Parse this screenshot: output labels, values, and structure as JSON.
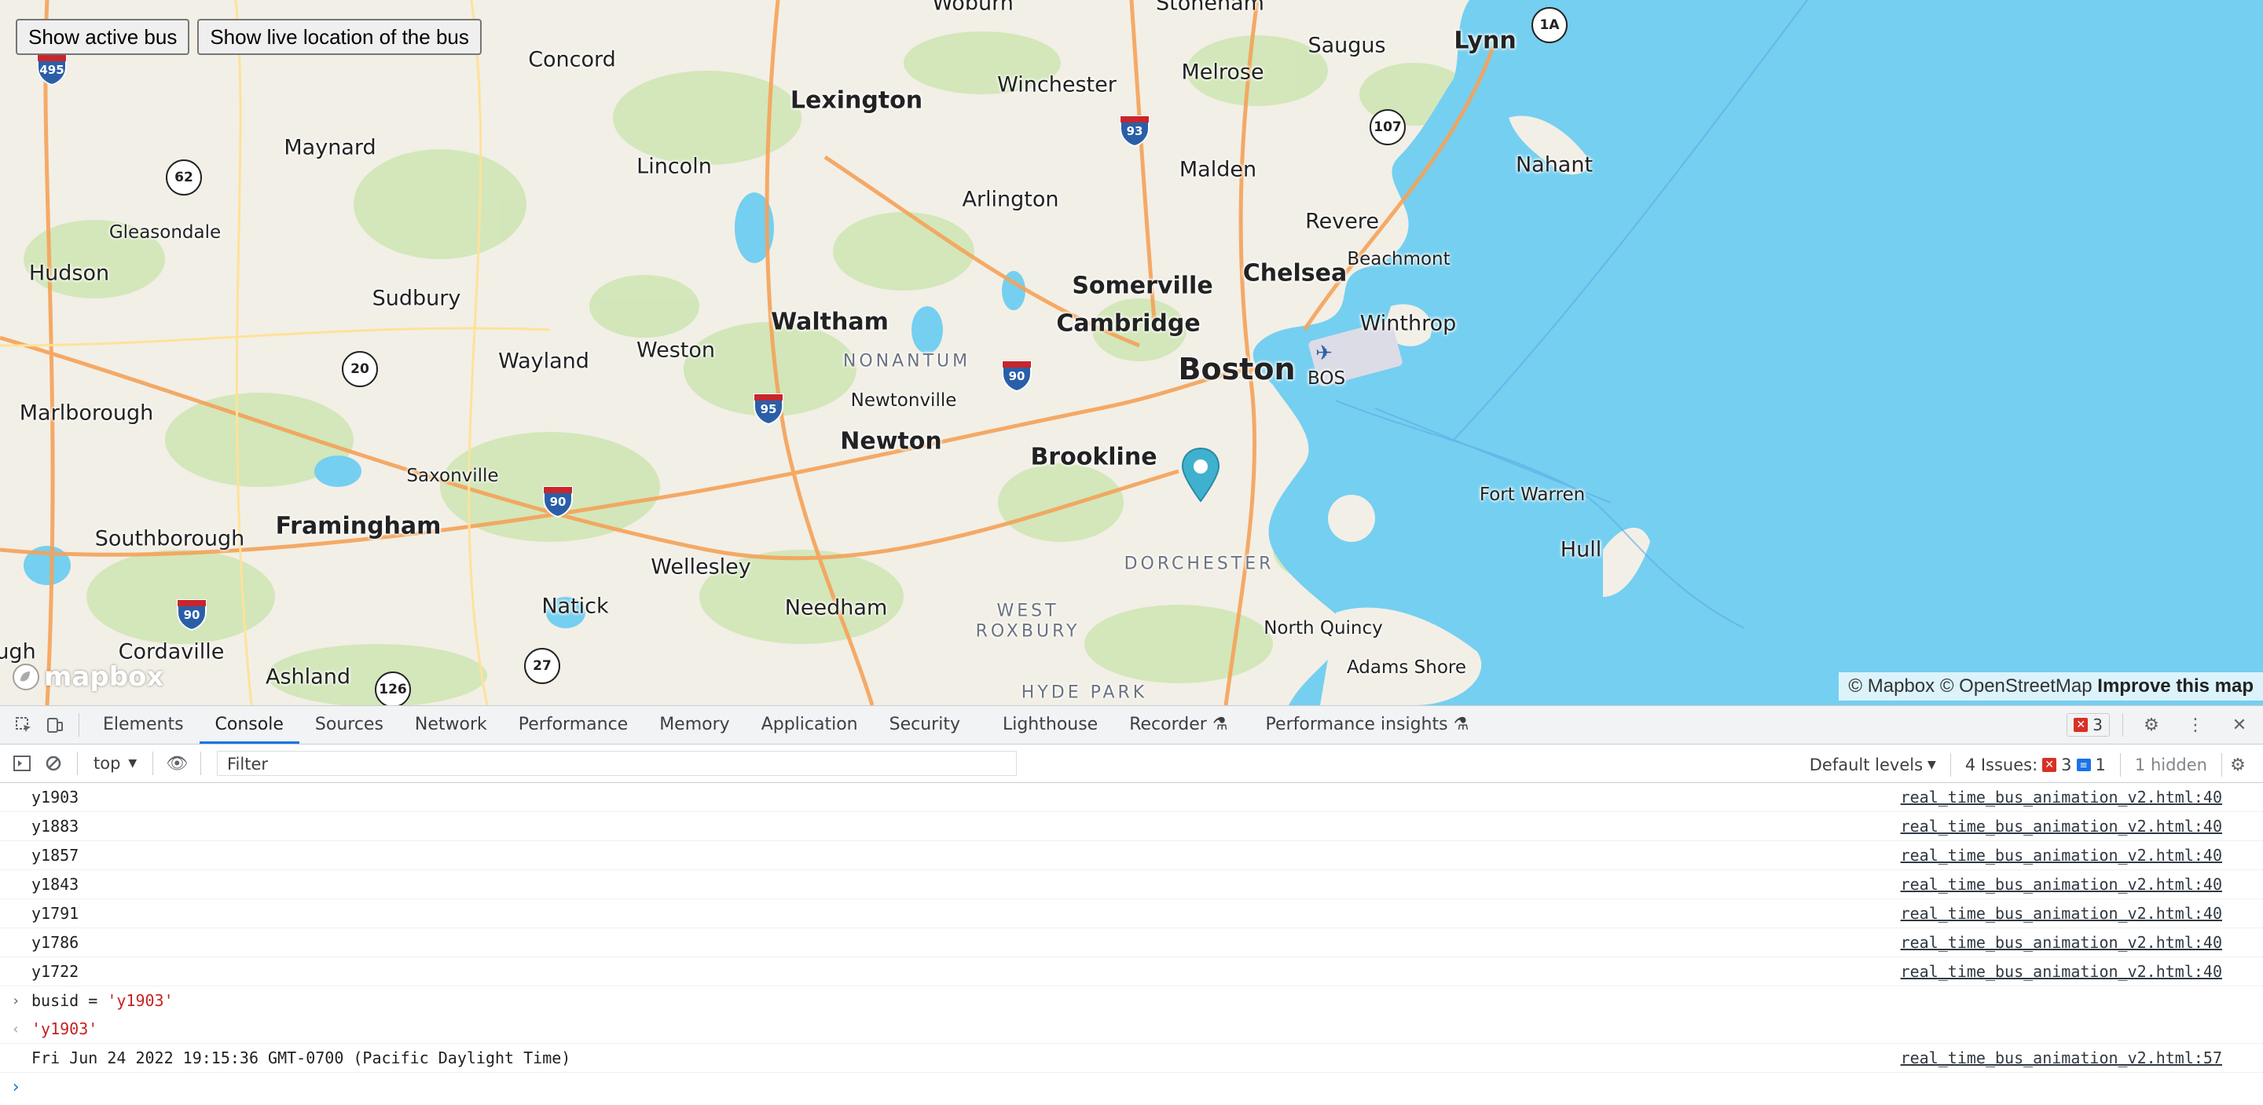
{
  "map": {
    "buttons": {
      "active_bus": "Show active bus",
      "live_location": "Show live location of the bus"
    },
    "labels": {
      "woburn": "Woburn",
      "stoneham": "Stoneham",
      "concord": "Concord",
      "lexington": "Lexington",
      "winchester": "Winchester",
      "melrose": "Melrose",
      "saugus": "Saugus",
      "lynn": "Lynn",
      "maynard": "Maynard",
      "lincoln": "Lincoln",
      "malden": "Malden",
      "nahant": "Nahant",
      "arlington": "Arlington",
      "gleasondale": "Gleasondale",
      "revere": "Revere",
      "hudson": "Hudson",
      "beachmont": "Beachmont",
      "somerville": "Somerville",
      "chelsea": "Chelsea",
      "sudbury": "Sudbury",
      "waltham": "Waltham",
      "cambridge": "Cambridge",
      "winthrop": "Winthrop",
      "wayland": "Wayland",
      "weston": "Weston",
      "nonantum": "NONANTUM",
      "boston": "Boston",
      "bos": "BOS",
      "newtonville": "Newtonville",
      "marlborough": "Marlborough",
      "newton": "Newton",
      "brookline": "Brookline",
      "saxonville": "Saxonville",
      "fort_warren": "Fort Warren",
      "southborough": "Southborough",
      "framingham": "Framingham",
      "dorchester": "DORCHESTER",
      "hull": "Hull",
      "wellesley": "Wellesley",
      "natick": "Natick",
      "needham": "Needham",
      "west": "WEST",
      "roxbury": "ROXBURY",
      "north_quincy": "North Quincy",
      "cordaville": "Cordaville",
      "hugh": "ugh",
      "ashland": "Ashland",
      "hyde_park": "HYDE PARK",
      "adams_shore": "Adams Shore"
    },
    "shields": {
      "i495": "495",
      "r62": "62",
      "r1a": "1A",
      "r107": "107",
      "i93": "93",
      "r20": "20",
      "i95": "95",
      "i90a": "90",
      "i90b": "90",
      "i90c": "90",
      "r27": "27",
      "r126": "126"
    },
    "logo": "mapbox",
    "attribution": {
      "mapbox": "© Mapbox",
      "osm": "© OpenStreetMap",
      "improve": "Improve this map"
    }
  },
  "devtools": {
    "tabs": [
      "Elements",
      "Console",
      "Sources",
      "Network",
      "Performance",
      "Memory",
      "Application",
      "Security",
      "Lighthouse",
      "Recorder",
      "Performance insights"
    ],
    "error_count": "3",
    "context": "top",
    "filter_placeholder": "Filter",
    "levels": "Default levels",
    "issues_label": "4 Issues:",
    "issues_errors": "3",
    "issues_info": "1",
    "hidden": "1 hidden",
    "logs": [
      {
        "text": "y1903",
        "src": "real_time_bus_animation_v2.html:40"
      },
      {
        "text": "y1883",
        "src": "real_time_bus_animation_v2.html:40"
      },
      {
        "text": "y1857",
        "src": "real_time_bus_animation_v2.html:40"
      },
      {
        "text": "y1843",
        "src": "real_time_bus_animation_v2.html:40"
      },
      {
        "text": "y1791",
        "src": "real_time_bus_animation_v2.html:40"
      },
      {
        "text": "y1786",
        "src": "real_time_bus_animation_v2.html:40"
      },
      {
        "text": "y1722",
        "src": "real_time_bus_animation_v2.html:40"
      }
    ],
    "input_prefix": "busid = ",
    "input_value": "'y1903'",
    "output_value": "'y1903'",
    "date_log": {
      "text": "Fri Jun 24 2022 19:15:36 GMT-0700 (Pacific Daylight Time)",
      "src": "real_time_bus_animation_v2.html:57"
    }
  },
  "colors": {
    "water": "#75cff0",
    "land": "#f2efe6",
    "park": "#cfe6b5",
    "highway": "#f5a259",
    "accent": "#1a73e8",
    "marker": "#3fb1ce"
  }
}
